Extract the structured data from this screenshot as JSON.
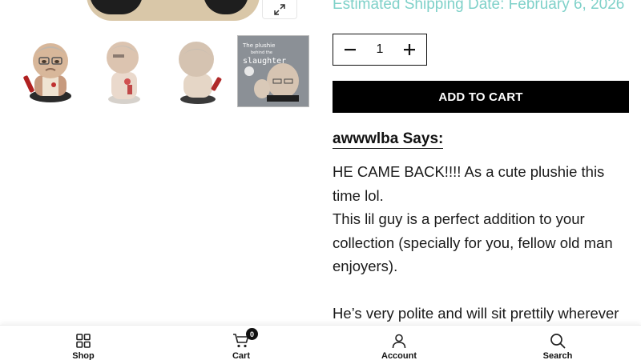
{
  "product": {
    "shipping_text": "Estimated Shipping Date: February 6, 2026",
    "zoom_icon": "expand-icon",
    "thumbnails": [
      {
        "name": "plushie-front"
      },
      {
        "name": "plushie-side"
      },
      {
        "name": "plushie-back"
      },
      {
        "name": "plushie-poster",
        "text_line1": "The plushie",
        "text_line2": "behind the",
        "text_line3": "slaughter"
      }
    ],
    "quantity": "1",
    "add_to_cart_label": "ADD TO CART"
  },
  "review": {
    "author": "awwwlba",
    "says_suffix": " Says:",
    "lines": [
      "HE CAME BACK!!!! As a cute plushie this time lol.",
      "This lil guy is a perfect addition to your collection (specially for you, fellow old man enjoyers).",
      "He’s very polite and will sit prettily wherever"
    ]
  },
  "bottom_nav": {
    "items": [
      {
        "label": "Shop",
        "icon": "grid-icon"
      },
      {
        "label": "Cart",
        "icon": "cart-icon",
        "badge": "0"
      },
      {
        "label": "Account",
        "icon": "user-icon"
      },
      {
        "label": "Search",
        "icon": "search-icon"
      }
    ]
  },
  "colors": {
    "shipping": "#7fd1c9",
    "button_bg": "#000000",
    "text": "#111111"
  }
}
